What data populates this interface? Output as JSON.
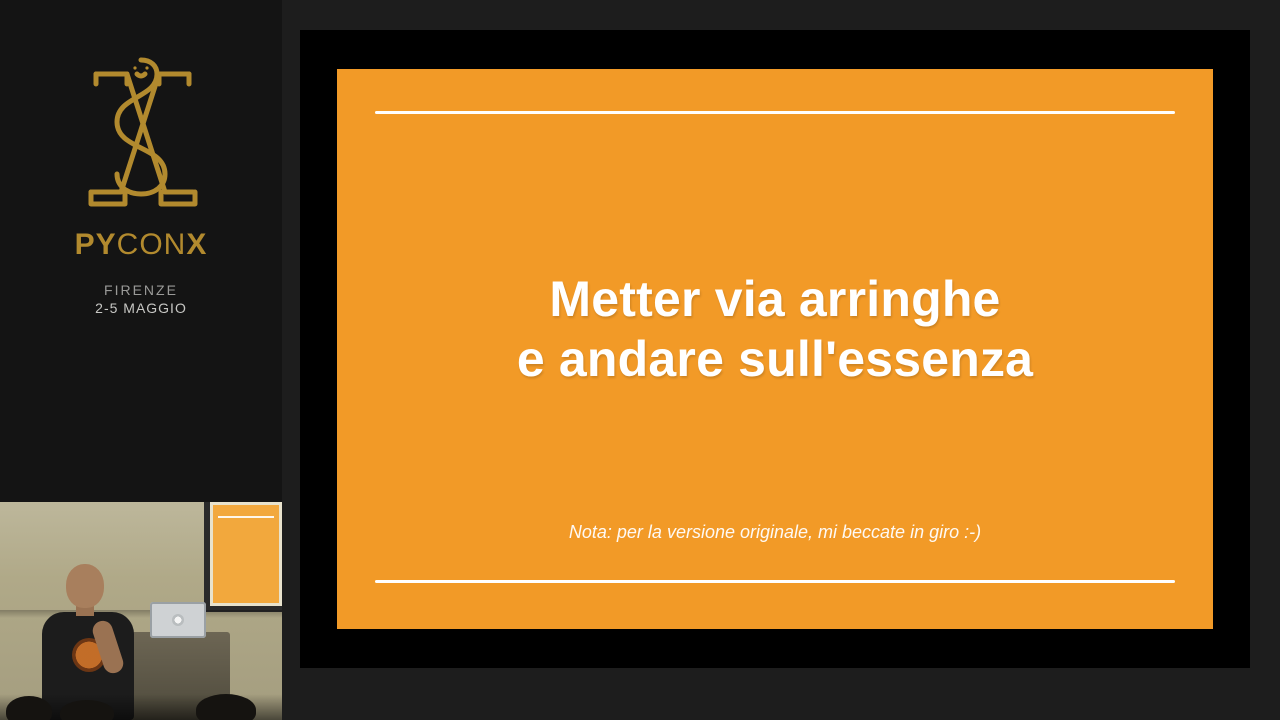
{
  "brand": {
    "left": "PY",
    "mid": "CON",
    "right": "X"
  },
  "event": {
    "location": "FIRENZE",
    "dates": "2-5 MAGGIO"
  },
  "slide": {
    "title_line1": "Metter via arringhe",
    "title_line2": "e andare sull'essenza",
    "note": "Nota: per  la versione originale, mi beccate in giro :-)"
  },
  "colors": {
    "slide_bg": "#f29a27",
    "brand_gold": "#b28a2e",
    "stage_bg": "#1d1d1d",
    "sidebar_bg": "#141414"
  }
}
